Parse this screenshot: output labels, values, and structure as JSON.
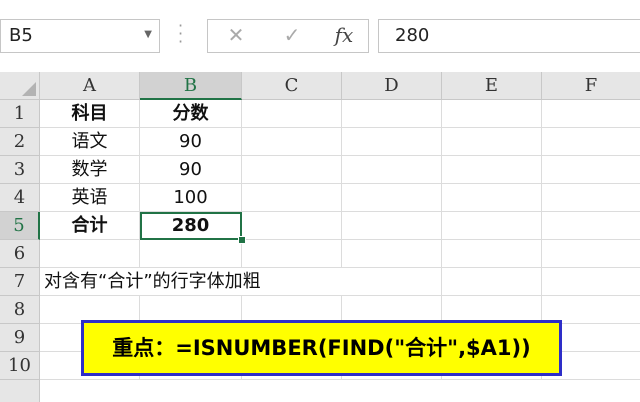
{
  "namebox": {
    "value": "B5"
  },
  "formula_bar": {
    "cancel_glyph": "✕",
    "ok_glyph": "✓",
    "fx_label": "fx",
    "value": "280"
  },
  "columns": [
    "A",
    "B",
    "C",
    "D",
    "E",
    "F"
  ],
  "rows": [
    "1",
    "2",
    "3",
    "4",
    "5",
    "6",
    "7",
    "8",
    "9",
    "10"
  ],
  "cells": {
    "A1": "科目",
    "B1": "分数",
    "A2": "语文",
    "B2": "90",
    "A3": "数学",
    "B3": "90",
    "A4": "英语",
    "B4": "100",
    "A5": "合计",
    "B5": "280",
    "A7": "对含有“合计”的行字体加粗"
  },
  "callout": {
    "text": "重点：=ISNUMBER(FIND(\"合计\",$A1))"
  },
  "colors": {
    "accent": "#217346",
    "callout_bg": "#ffff00",
    "callout_border": "#2e2ec8"
  }
}
